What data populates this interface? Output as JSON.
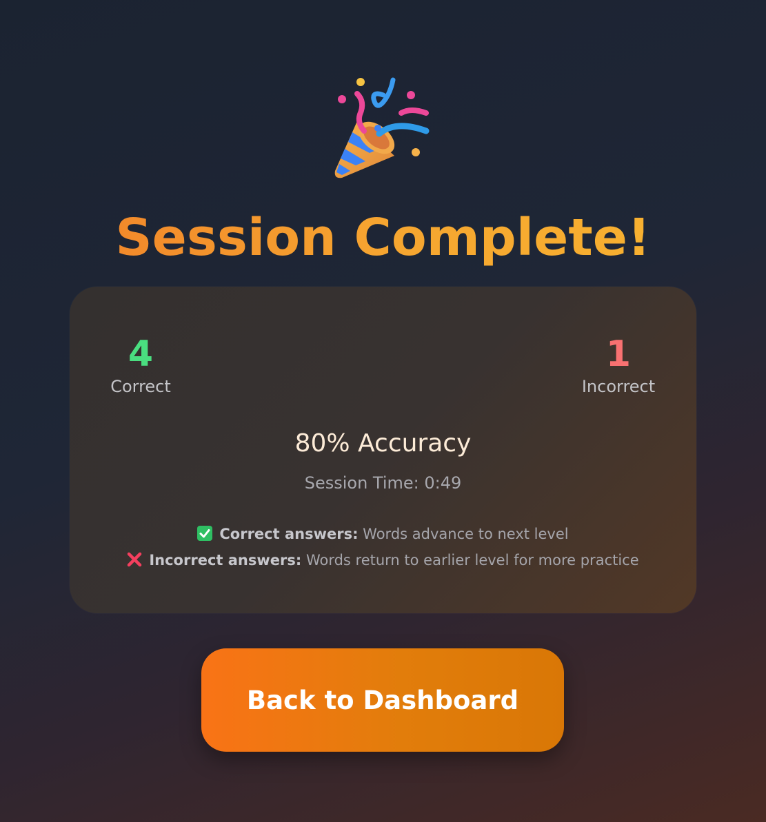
{
  "header": {
    "icon": "party-popper-icon",
    "title": "Session Complete!"
  },
  "results": {
    "correct": {
      "value": "4",
      "label": "Correct"
    },
    "incorrect": {
      "value": "1",
      "label": "Incorrect"
    },
    "accuracy": "80% Accuracy",
    "session_time": "Session Time: 0:49",
    "notes": [
      {
        "icon": "check-mark-icon",
        "label": "Correct answers:",
        "text": " Words advance to next level"
      },
      {
        "icon": "cross-mark-icon",
        "label": "Incorrect answers:",
        "text": " Words return to earlier level for more practice"
      }
    ]
  },
  "actions": {
    "back_label": "Back to Dashboard"
  },
  "colors": {
    "accent_orange": "#f97316",
    "title_gold": "#f6a530",
    "correct_green": "#4ade80",
    "incorrect_red": "#f87171"
  }
}
